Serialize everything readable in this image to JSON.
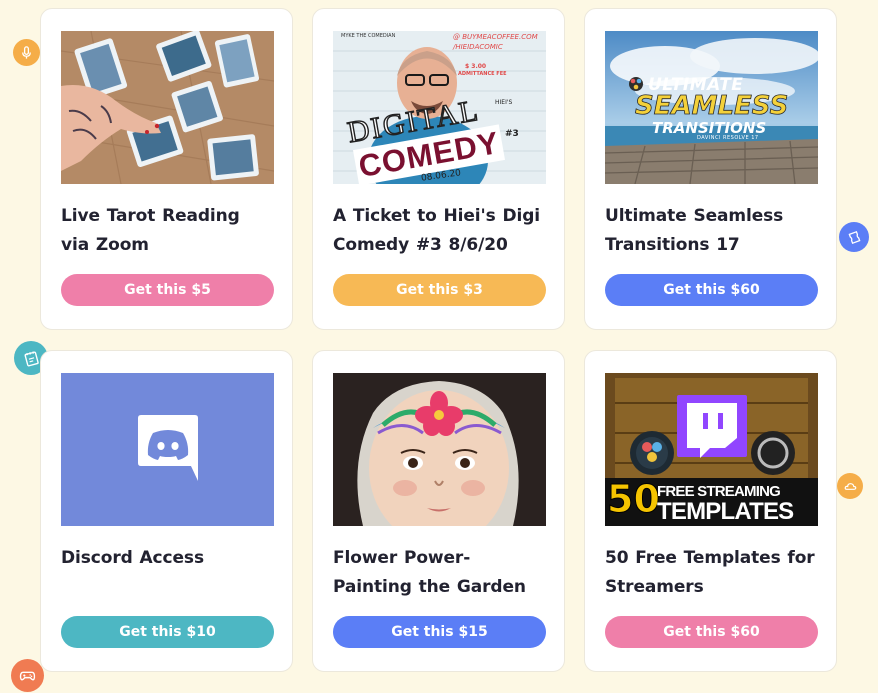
{
  "cards": [
    {
      "title": "Live Tarot Reading via Zoom",
      "button_label": "Get this",
      "price": "$5",
      "button_color": "#ef7fa9"
    },
    {
      "title": "A Ticket to Hiei's Digi Comedy #3 8/6/20",
      "button_label": "Get this",
      "price": "$3",
      "button_color": "#f7b955",
      "poster": {
        "top_text": "MYKE THE COMEDIAN",
        "url_line1": "@ BUYMEACOFFEE.COM",
        "url_line2": "/HIEIDACOMIC",
        "fee": "$ 3.00",
        "fee_label": "ADMITTANCE FEE",
        "hieis": "HIEI'S",
        "digital": "DIGITAL",
        "comedy": "COMEDY",
        "number": "#3",
        "date": "08.06.20"
      }
    },
    {
      "title": "Ultimate Seamless Transitions 17",
      "button_label": "Get this",
      "price": "$60",
      "button_color": "#5b7ef6",
      "poster": {
        "line1": "ULTIMATE",
        "line2": "SEAMLESS",
        "line3": "TRANSITIONS",
        "line4": "DAVINCI RESOLVE 17"
      }
    },
    {
      "title": "Discord Access",
      "button_label": "Get this",
      "price": "$10",
      "button_color": "#4db7c3"
    },
    {
      "title": "Flower Power- Painting the Garden",
      "button_label": "Get this",
      "price": "$15",
      "button_color": "#5b7ef6"
    },
    {
      "title": "50 Free Templates for Streamers",
      "button_label": "Get this",
      "price": "$60",
      "button_color": "#ef7fa9",
      "poster": {
        "num": "50",
        "line1": "FREE STREAMING",
        "line2": "TEMPLATES"
      }
    }
  ],
  "side_icons": [
    {
      "name": "microphone-icon",
      "color": "#f5ad48"
    },
    {
      "name": "ticket-icon",
      "color": "#5b7ef6"
    },
    {
      "name": "notepad-icon",
      "color": "#4db7c3"
    },
    {
      "name": "cloud-icon",
      "color": "#f5ad48"
    },
    {
      "name": "gamepad-icon",
      "color": "#f07b52"
    }
  ]
}
